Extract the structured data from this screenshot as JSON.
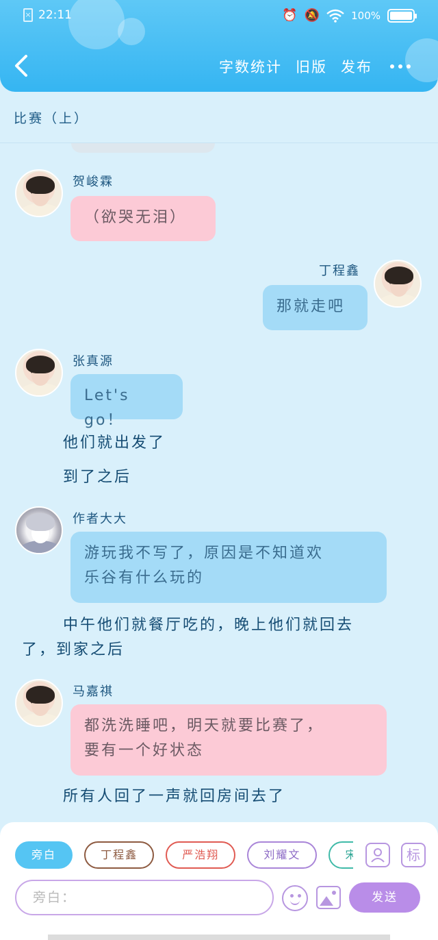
{
  "status_bar": {
    "time": "22:11",
    "battery": "100%"
  },
  "header": {
    "actions": [
      "字数统计",
      "旧版",
      "发布"
    ]
  },
  "chapter_title": "比赛（上）",
  "messages": [
    {
      "side": "left",
      "speaker": "贺峻霖",
      "text": "（欲哭无泪）",
      "color": "pink"
    },
    {
      "side": "right",
      "speaker": "丁程鑫",
      "text": "那就走吧",
      "color": "blue"
    },
    {
      "side": "left",
      "speaker": "张真源",
      "text": "Let's go！",
      "color": "blue"
    }
  ],
  "narration_1": "他们就出发了",
  "narration_2": "到了之后",
  "author_message": {
    "speaker": "作者大大",
    "line1": "游玩我不写了，原因是不知道欢",
    "line2": "乐谷有什么玩的"
  },
  "narration_3_line1": "中午他们就餐厅吃的，晚上他们就回去",
  "narration_3_line2": "了，到家之后",
  "ma_message": {
    "speaker": "马嘉祺",
    "line1": "都洗洗睡吧，明天就要比赛了，",
    "line2": "要有一个好状态"
  },
  "narration_4": "所有人回了一声就回房间去了",
  "role_chips": [
    "旁白",
    "丁程鑫",
    "严浩翔",
    "刘耀文",
    "宋亚轩"
  ],
  "tools": {
    "mark": "标"
  },
  "input": {
    "placeholder": "旁白："
  },
  "send_label": "发送",
  "colors": {
    "header": "#35b5f2",
    "background": "#d9f0fb",
    "bubble_pink": "#fccad6",
    "bubble_blue": "#a4dbf7",
    "send": "#b98de8"
  }
}
